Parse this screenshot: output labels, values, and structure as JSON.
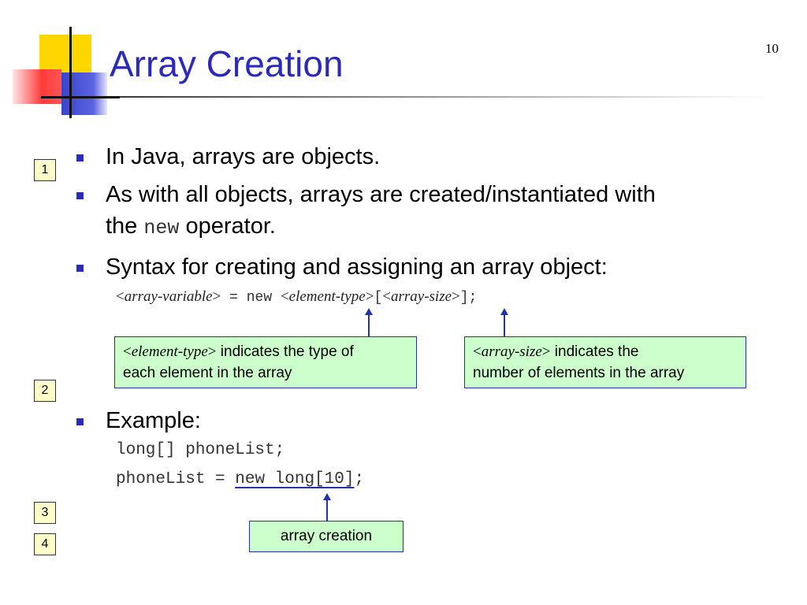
{
  "slide": {
    "title": "Array Creation",
    "page_number": "10"
  },
  "bullets": {
    "b1": "In Java, arrays are objects.",
    "b2_line1": "As with all objects, arrays are created/instantiated with",
    "b2_line2_pre": "the",
    "b2_code": "new",
    "b2_line2_post": "operator.",
    "b3": "Syntax for creating and assigning an array object:",
    "b4": "Example:"
  },
  "syntax": {
    "lt1": "<",
    "var": "array-variable",
    "gt1": ">",
    "eq_new": " = new ",
    "lt2": "<",
    "elem": "element-type",
    "gt2": ">",
    "lb": "[",
    "lt3": "<",
    "size": "array-size",
    "gt3": ">",
    "end": "];"
  },
  "notes": {
    "elem_lt": "<",
    "elem_term": "element-type",
    "elem_gt": ">",
    "elem_text1": " indicates the type of",
    "elem_text2": "each element in the array",
    "size_lt": "<",
    "size_term": "array-size",
    "size_gt": ">",
    "size_text1": " indicates the",
    "size_text2": "number of elements in the array",
    "array_creation": "array creation"
  },
  "example": {
    "line1": "long[] phoneList;",
    "line2_pre": "phoneList = ",
    "line2_underlined": "new long[10]",
    "line2_post": ";"
  },
  "markers": [
    "1",
    "2",
    "3",
    "4"
  ],
  "colors": {
    "title": "#2b2bb8",
    "bullet": "#2b2bb8",
    "note_fill": "#ccffcc",
    "note_border": "#2233aa",
    "marker_fill": "#ffffcc"
  }
}
